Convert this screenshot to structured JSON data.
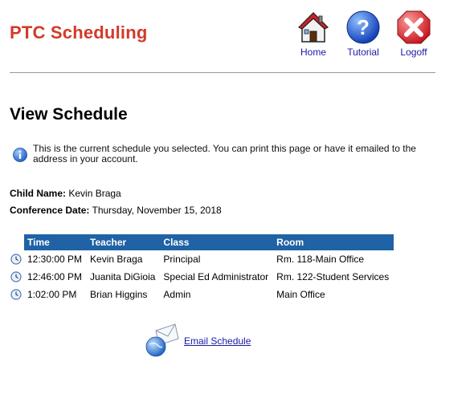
{
  "app": {
    "title": "PTC Scheduling"
  },
  "nav": {
    "home_label": "Home",
    "tutorial_label": "Tutorial",
    "logoff_label": "Logoff"
  },
  "page": {
    "title": "View Schedule",
    "info_text": "This is the current schedule you selected.  You can print this page or have it emailed to the address in your account."
  },
  "details": {
    "child_label": "Child Name:",
    "child_value": "Kevin Braga",
    "date_label": "Conference Date:",
    "date_value": "Thursday, November 15, 2018"
  },
  "schedule": {
    "headers": {
      "time": "Time",
      "teacher": "Teacher",
      "class": "Class",
      "room": "Room"
    },
    "rows": [
      {
        "time": "12:30:00 PM",
        "teacher": "Kevin Braga",
        "class": "Principal",
        "room": "Rm. 118-Main Office"
      },
      {
        "time": "12:46:00 PM",
        "teacher": "Juanita DiGioia",
        "class": "Special Ed Administrator",
        "room": "Rm. 122-Student Services"
      },
      {
        "time": "1:02:00 PM",
        "teacher": "Brian Higgins",
        "class": "Admin",
        "room": "Main Office"
      }
    ]
  },
  "email": {
    "link_label": "Email Schedule"
  },
  "colors": {
    "brand": "#d23a2a",
    "header_bg": "#1f62a5",
    "link": "#1a1aa6"
  },
  "icons": [
    "home-icon",
    "help-icon",
    "logoff-icon",
    "info-icon",
    "clock-icon",
    "email-icon"
  ]
}
